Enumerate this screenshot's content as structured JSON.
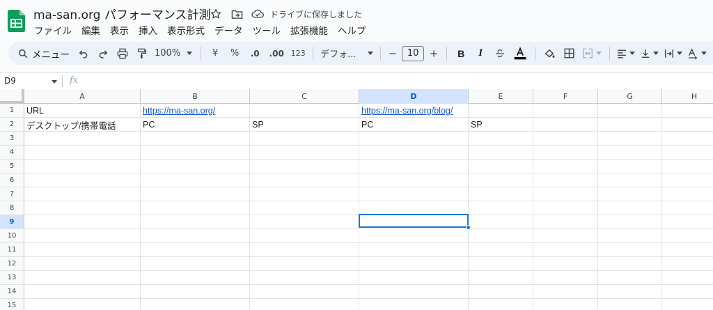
{
  "app": {
    "title": "ma-san.org パフォーマンス計測",
    "save_status": "ドライブに保存しました",
    "brand_color": "#0f9d58"
  },
  "menu": [
    "ファイル",
    "編集",
    "表示",
    "挿入",
    "表示形式",
    "データ",
    "ツール",
    "拡張機能",
    "ヘルプ"
  ],
  "toolbar": {
    "search_label": "メニュー",
    "zoom": "100%",
    "currency": "¥",
    "percent": "%",
    "dec_decrease": ".0",
    "dec_increase": ".00",
    "number_format": "123",
    "font_name": "デフォ...",
    "font_size": "10"
  },
  "formula_bar": {
    "cell_ref": "D9",
    "fx": "fx",
    "value": ""
  },
  "sheet": {
    "columns": [
      "A",
      "B",
      "C",
      "D",
      "E",
      "F",
      "G",
      "H"
    ],
    "selected_column": "D",
    "rows": [
      "1",
      "2",
      "3",
      "4",
      "5",
      "6",
      "7",
      "8",
      "9",
      "10",
      "11",
      "12",
      "13",
      "14",
      "15"
    ],
    "selected_row": "9",
    "cells": {
      "A1": "URL",
      "B1": "https://ma-san.org/",
      "D1": "https://ma-san.org/blog/",
      "A2": "デスクトップ/携帯電話",
      "B2": "PC",
      "C2": "SP",
      "D2": "PC",
      "E2": "SP"
    },
    "accent_color": "#1a73e8"
  }
}
